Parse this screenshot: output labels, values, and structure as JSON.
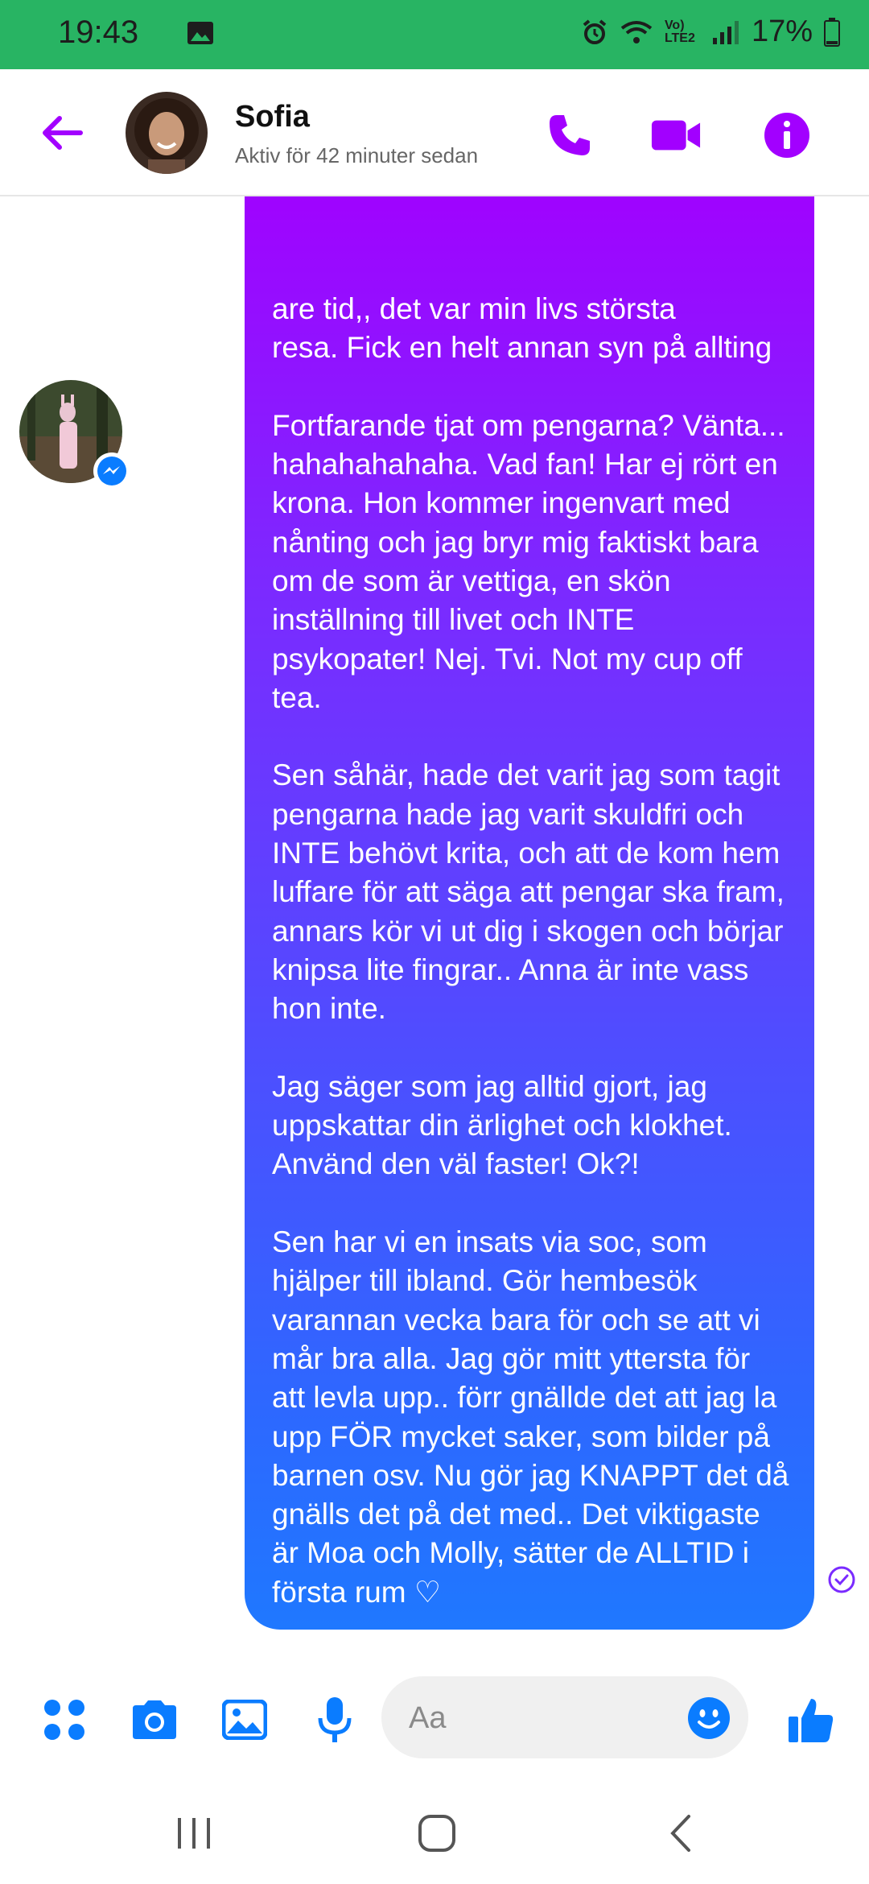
{
  "status_bar": {
    "time": "19:43",
    "network": "Vo) LTE2",
    "battery": "17%"
  },
  "header": {
    "name": "Sofia",
    "status": "Aktiv för 42 minuter sedan"
  },
  "message": {
    "partial_line": "are tid,, det var min livs största",
    "text": "resa. Fick en helt annan syn på allting\n\nFortfarande tjat om pengarna? Vänta... hahahahahaha. Vad fan! Har ej rört en krona. Hon kommer ingenvart med nånting och jag bryr mig faktiskt bara om de som är vettiga, en skön inställning till livet och INTE psykopater! Nej. Tvi. Not my cup off tea.\n\nSen såhär, hade det varit jag som tagit pengarna hade jag varit skuldfri och INTE behövt krita, och att de kom hem luffare för att säga att pengar ska fram, annars kör vi ut dig i skogen och börjar knipsa lite fingrar.. Anna är inte vass hon inte.\n\nJag säger som jag alltid gjort, jag uppskattar din ärlighet och klokhet. Använd den väl faster! Ok?!\n\nSen har vi en insats via soc, som hjälper till ibland. Gör hembesök varannan vecka bara för och se att vi mår bra alla. Jag gör mitt yttersta för att levla upp.. förr gnällde det att jag la upp FÖR mycket saker, som bilder på barnen osv. Nu gör jag KNAPPT det då gnälls det på det med.. Det viktigaste är Moa och Molly, sätter de ALLTID i första rum ♡"
  },
  "composer": {
    "placeholder": "Aa"
  },
  "colors": {
    "accent": "#a200ff",
    "messenger_blue": "#0a7cff",
    "status_green": "#28b463"
  }
}
